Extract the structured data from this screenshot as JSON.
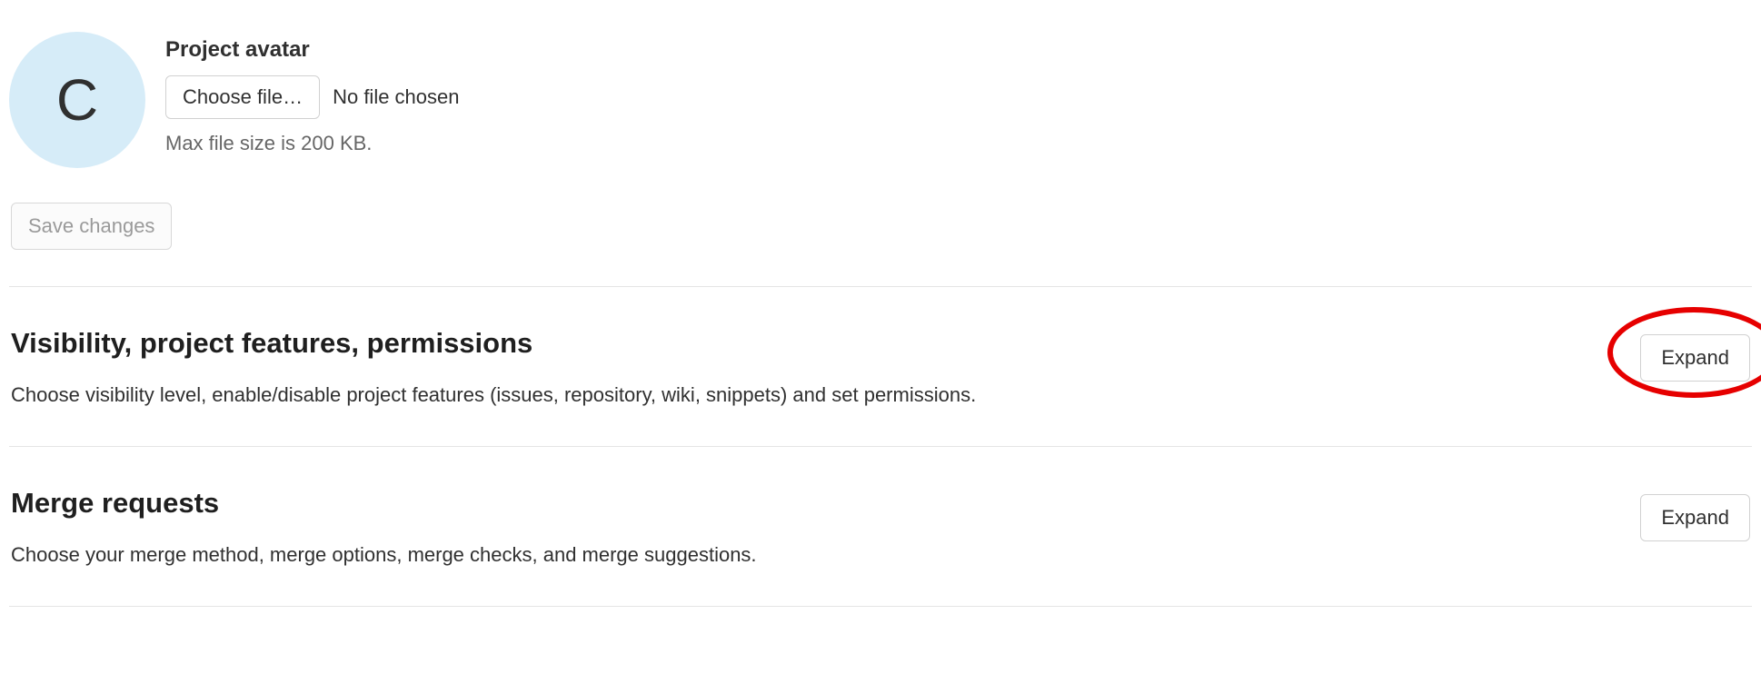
{
  "avatar": {
    "label": "Project avatar",
    "initial": "C",
    "choose_file_label": "Choose file…",
    "no_file_text": "No file chosen",
    "help_text": "Max file size is 200 KB."
  },
  "save_button_label": "Save changes",
  "sections": [
    {
      "title": "Visibility, project features, permissions",
      "description": "Choose visibility level, enable/disable project features (issues, repository, wiki, snippets) and set permissions.",
      "expand_label": "Expand",
      "highlighted": true
    },
    {
      "title": "Merge requests",
      "description": "Choose your merge method, merge options, merge checks, and merge suggestions.",
      "expand_label": "Expand",
      "highlighted": false
    }
  ]
}
